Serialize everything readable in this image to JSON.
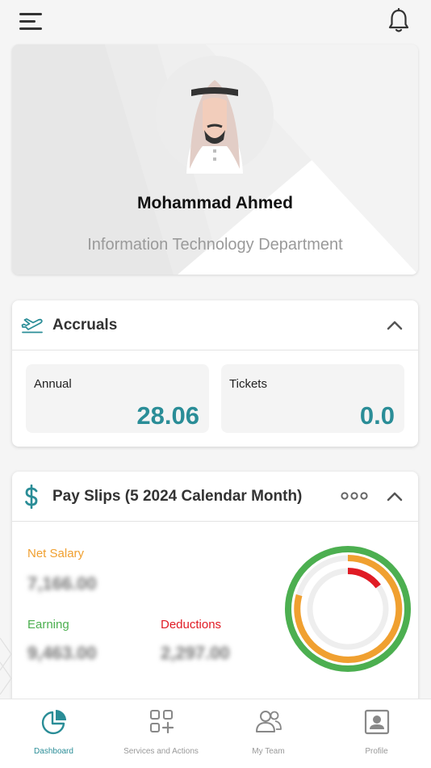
{
  "profile": {
    "name": "Mohammad Ahmed",
    "department": "Information Technology Department"
  },
  "accruals": {
    "title": "Accruals",
    "tiles": [
      {
        "label": "Annual",
        "value": "28.06"
      },
      {
        "label": "Tickets",
        "value": "0.0"
      }
    ]
  },
  "payslips": {
    "title": "Pay Slips (5 2024 Calendar Month)",
    "net_salary_label": "Net Salary",
    "net_salary_value": "7,166.00",
    "earning_label": "Earning",
    "earning_value": "9,463.00",
    "deductions_label": "Deductions",
    "deductions_value": "2,297.00"
  },
  "nav": [
    {
      "label": "Dashboard",
      "icon": "dashboard-pie-icon",
      "active": true
    },
    {
      "label": "Services and Actions",
      "icon": "services-grid-icon",
      "active": false
    },
    {
      "label": "My Team",
      "icon": "team-icon",
      "active": false
    },
    {
      "label": "Profile",
      "icon": "profile-card-icon",
      "active": false
    }
  ],
  "colors": {
    "accent": "#2a8d97",
    "net_salary": "#f0a030",
    "earning": "#4caf50",
    "deductions": "#e01b24"
  }
}
